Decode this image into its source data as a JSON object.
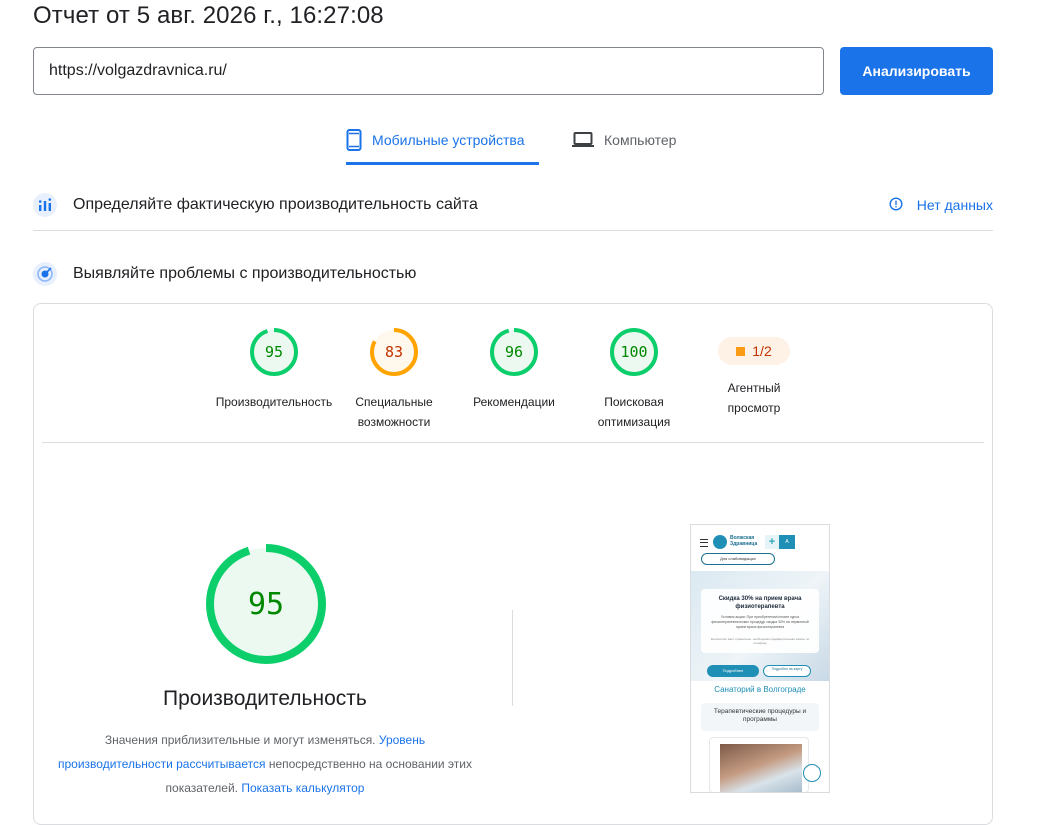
{
  "header": {
    "report_title": "Отчет от 5 авг. 2026 г., 16:27:08",
    "url_value": "https://volgazdravnica.ru/",
    "analyze_label": "Анализировать"
  },
  "tabs": [
    {
      "label": "Мобильные устройства",
      "icon": "smartphone-icon",
      "active": true
    },
    {
      "label": "Компьютер",
      "icon": "laptop-icon",
      "active": false
    }
  ],
  "field_data": {
    "title": "Определяйте фактическую производительность сайта",
    "no_data_label": "Нет данных",
    "icon": "field-data-icon"
  },
  "lab_data": {
    "title": "Выявляйте проблемы с производительностью",
    "icon": "lab-data-icon"
  },
  "scores": [
    {
      "id": "performance",
      "value": "95",
      "label": "Производительность",
      "color": "#0cce6b",
      "fraction": 0.95
    },
    {
      "id": "accessibility",
      "value": "83",
      "label": "Специальные возможности",
      "color": "#ffa400",
      "fraction": 0.83
    },
    {
      "id": "best-practices",
      "value": "96",
      "label": "Рекомендации",
      "color": "#0cce6b",
      "fraction": 0.96
    },
    {
      "id": "seo",
      "value": "100",
      "label": "Поисковая оптимизация",
      "color": "#0cce6b",
      "fraction": 1.0
    },
    {
      "id": "agentic",
      "value": "1/2",
      "label": "Агентный просмотр",
      "color": "#fa9b16"
    }
  ],
  "big_score": {
    "value": "95",
    "label": "Производительность",
    "fraction": 0.95,
    "color": "#0cce6b"
  },
  "note": {
    "text1": "Значения приблизительные и могут изменяться.",
    "link1": "Уровень производительности рассчитывается",
    "text2": "непосредственно на основании этих показателей.",
    "link2": "Показать калькулятор"
  },
  "screenshot": {
    "brand": "Волжская Здравница",
    "access_btn": "Для слабовидящих",
    "hero_title": "Скидка 30% на прием врача физиотерапевта",
    "hero_text": "Условия акции: При приобретении/оплате курса физиотерапевтических процедур скидка 30% на первичный прием врача физиотерапевта",
    "hero_small": "Количество мест ограничено, необходимо предварительная запись по телефону",
    "btn_more": "Подробнее",
    "btn_apply": "Подробно на карту",
    "sanatorium": "Санаторий в Волгограде",
    "box_title": "Терапевтические процедуры и программы"
  },
  "colors": {
    "accent": "#1a73e8",
    "pass": "#0cce6b",
    "average": "#ffa400",
    "average_text": "#c33300",
    "pass_text": "#008800"
  }
}
